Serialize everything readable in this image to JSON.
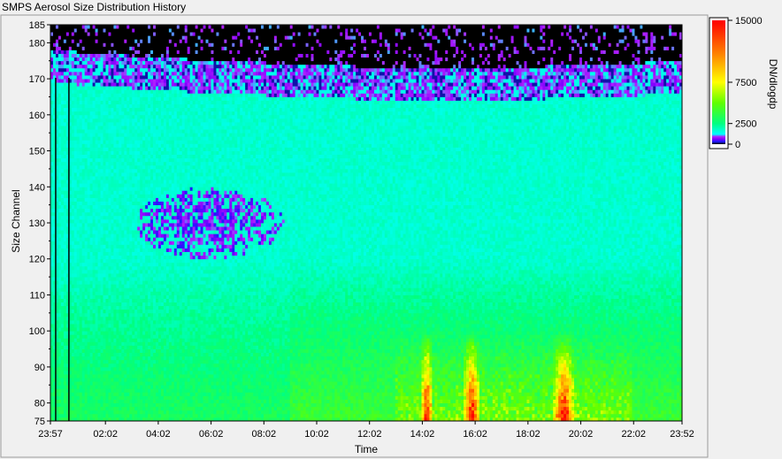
{
  "window": {
    "title": "SMPS Aerosol Size Distribution History"
  },
  "colors": {
    "background": "#f0f0f0",
    "plot_frame": "#000000",
    "outer_frame": "#9a9a9a"
  },
  "chart_data": {
    "type": "heatmap",
    "title": "SMPS Aerosol Size Distribution History",
    "xlabel": "Time",
    "ylabel": "Size Channel",
    "x_ticks": [
      "23:57",
      "02:02",
      "04:02",
      "06:02",
      "08:02",
      "10:02",
      "12:02",
      "14:02",
      "16:02",
      "18:02",
      "20:02",
      "22:02",
      "23:52"
    ],
    "x_tick_hours": [
      -0.05,
      2.033,
      4.033,
      6.033,
      8.033,
      10.033,
      12.033,
      14.033,
      16.033,
      18.033,
      20.033,
      22.033,
      23.867
    ],
    "xlim_hours": [
      -0.05,
      23.867
    ],
    "y_ticks": [
      75,
      80,
      90,
      100,
      110,
      120,
      130,
      140,
      150,
      160,
      170,
      180,
      185
    ],
    "ylim": [
      75,
      185
    ],
    "colorbar": {
      "label": "DN/dlogdp",
      "ticks": [
        15000,
        7500,
        2500,
        0
      ],
      "range": [
        0,
        15000
      ],
      "stops": [
        {
          "value": 0,
          "color": "#000000"
        },
        {
          "value": 300,
          "color": "#1a1aff"
        },
        {
          "value": 600,
          "color": "#8000ff"
        },
        {
          "value": 900,
          "color": "#b020ff"
        },
        {
          "value": 1200,
          "color": "#00ffff"
        },
        {
          "value": 2500,
          "color": "#00ff80"
        },
        {
          "value": 5000,
          "color": "#60ff00"
        },
        {
          "value": 7500,
          "color": "#ffff00"
        },
        {
          "value": 11000,
          "color": "#ff8000"
        },
        {
          "value": 15000,
          "color": "#ff0000"
        }
      ]
    },
    "vertical_markers_hours": [
      0.15,
      0.65
    ]
  }
}
